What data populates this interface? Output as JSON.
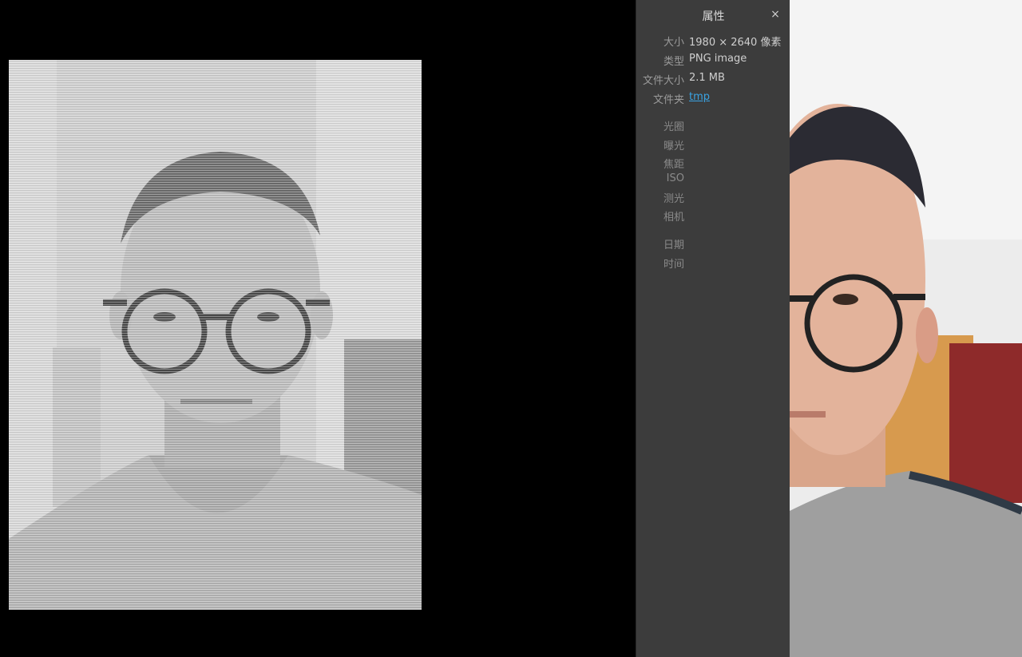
{
  "panel": {
    "title": "属性",
    "close_glyph": "×",
    "props": {
      "size_label": "大小",
      "size_value": "1980 × 2640 像素",
      "type_label": "类型",
      "type_value": "PNG image",
      "filesize_label": "文件大小",
      "filesize_value": "2.1 MB",
      "folder_label": "文件夹",
      "folder_value": "tmp"
    },
    "exif": {
      "aperture_label": "光圈",
      "exposure_label": "曝光",
      "focal_label": "焦距",
      "iso_label": "ISO",
      "metering_label": "测光",
      "camera_label": "相机",
      "date_label": "日期",
      "time_label": "时间"
    }
  },
  "icons": {
    "close": "close-icon"
  },
  "colors": {
    "viewer_bg": "#000000",
    "panel_bg": "#3c3c3c",
    "link": "#3aa3e3"
  }
}
